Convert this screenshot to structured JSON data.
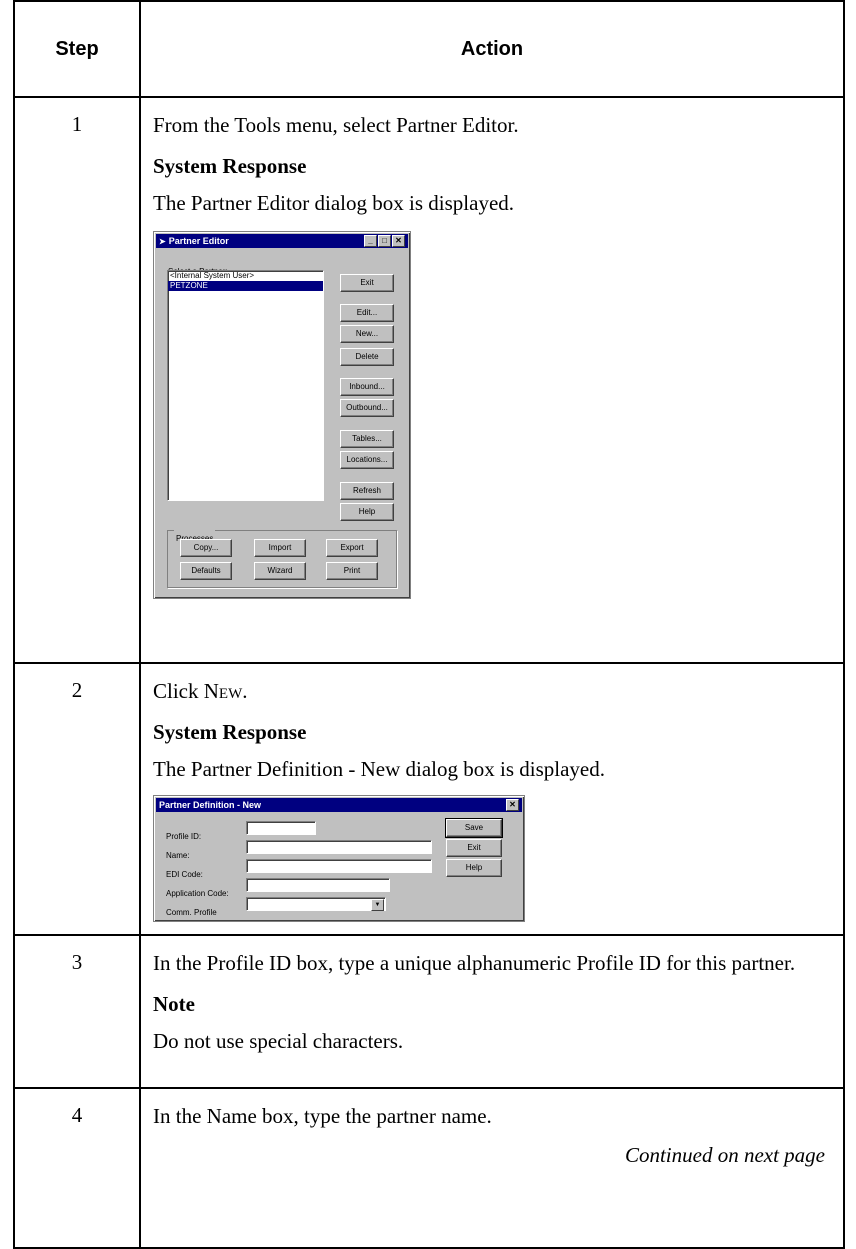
{
  "table": {
    "header_step": "Step",
    "header_action": "Action"
  },
  "steps": [
    {
      "num": "1",
      "text": "From the Tools menu, select Partner Editor.",
      "resp_head": "System Response",
      "resp_text": "The Partner Editor dialog box is displayed."
    },
    {
      "num": "2",
      "text_prefix": "Click ",
      "text_sc": "New",
      "text_suffix": ".",
      "resp_head": "System Response",
      "resp_text": "The Partner Definition - New dialog box is displayed."
    },
    {
      "num": "3",
      "text": "In the Profile ID box, type a unique alphanumeric Profile ID for this partner.",
      "note_head": "Note",
      "note_text": "Do not use special characters."
    },
    {
      "num": "4",
      "text": "In the Name box, type the partner name.",
      "continued": "Continued on next page"
    }
  ],
  "partner_editor": {
    "title": "Partner Editor",
    "select_label": "Select a Partner:",
    "partners": [
      "<Internal System User>",
      "PETZONE"
    ],
    "selected_index": 1,
    "buttons": [
      "Exit",
      "Edit...",
      "New...",
      "Delete",
      "Inbound...",
      "Outbound...",
      "Tables...",
      "Locations...",
      "Refresh",
      "Help"
    ],
    "processes_label": "Processes",
    "process_buttons": [
      "Copy...",
      "Import",
      "Export",
      "Defaults",
      "Wizard",
      "Print"
    ]
  },
  "partner_def": {
    "title": "Partner Definition - New",
    "labels": [
      "Profile ID:",
      "Name:",
      "EDI Code:",
      "Application Code:",
      "Comm. Profile"
    ],
    "buttons": [
      "Save",
      "Exit",
      "Help"
    ]
  }
}
